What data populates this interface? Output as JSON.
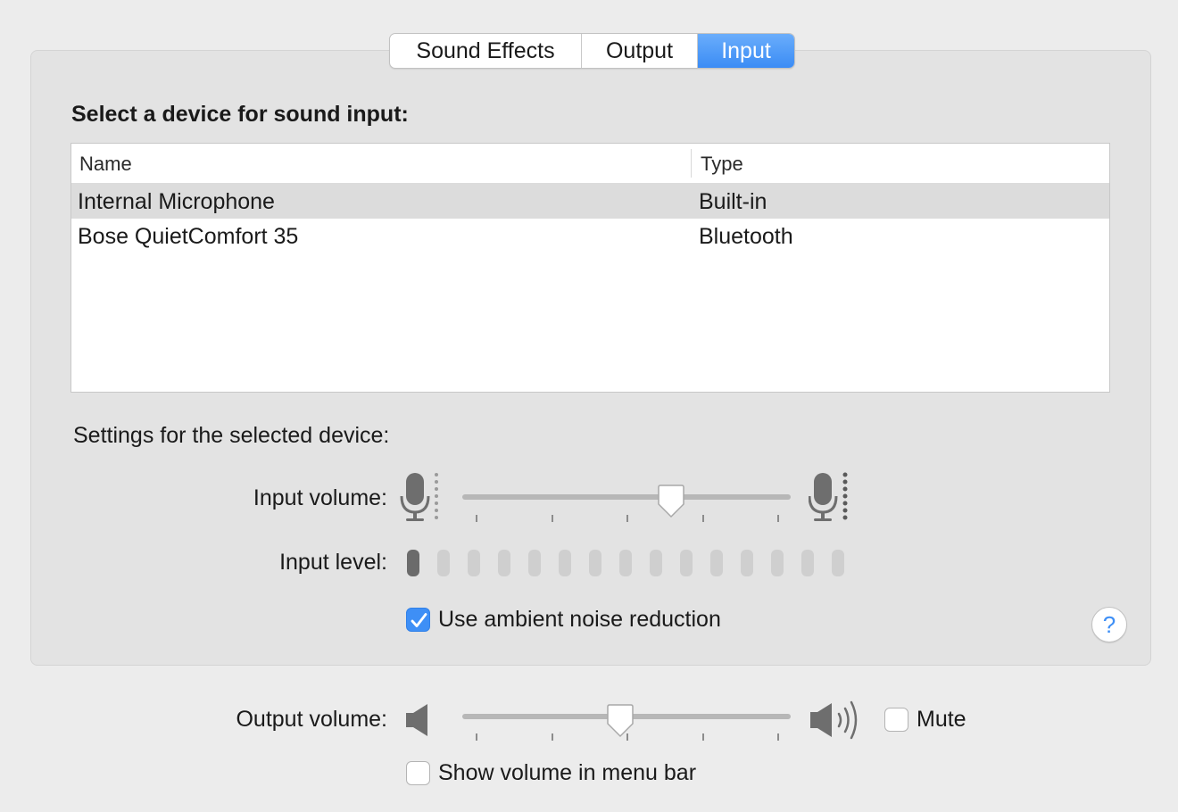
{
  "tabs": [
    {
      "label": "Sound Effects",
      "active": false
    },
    {
      "label": "Output",
      "active": false
    },
    {
      "label": "Input",
      "active": true
    }
  ],
  "device_section": {
    "title": "Select a device for sound input:",
    "columns": [
      "Name",
      "Type"
    ],
    "rows": [
      {
        "name": "Internal Microphone",
        "type": "Built-in",
        "selected": true
      },
      {
        "name": "Bose QuietComfort 35",
        "type": "Bluetooth",
        "selected": false
      }
    ]
  },
  "settings": {
    "title": "Settings for the selected device:",
    "input_volume_label": "Input volume:",
    "input_volume_fraction": 0.65,
    "input_level_label": "Input level:",
    "input_level_segments": 15,
    "input_level_active": 1,
    "noise_reduction_label": "Use ambient noise reduction",
    "noise_reduction_checked": true,
    "help_label": "?"
  },
  "output": {
    "volume_label": "Output volume:",
    "volume_fraction": 0.48,
    "mute_label": "Mute",
    "mute_checked": false,
    "show_in_menu_bar_label": "Show volume in menu bar",
    "show_in_menu_bar_checked": false
  },
  "icons": {
    "microphone_low": "microphone-low-icon",
    "microphone_high": "microphone-high-icon",
    "speaker_low": "speaker-low-icon",
    "speaker_high": "speaker-high-icon",
    "checkmark": "checkmark-icon"
  },
  "colors": {
    "accent": "#3e8ff6",
    "panel": "#e3e3e3",
    "window": "#ececec"
  }
}
